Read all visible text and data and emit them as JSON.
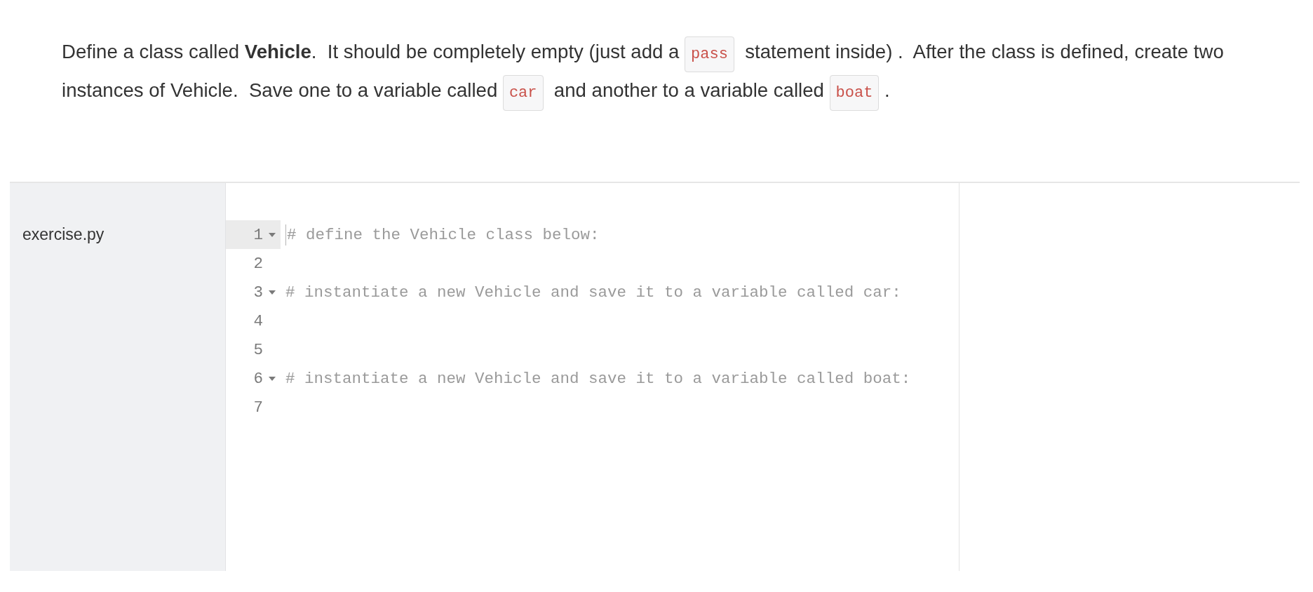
{
  "instructions": {
    "segments": [
      {
        "kind": "text",
        "text": "Define a class called **Vehicle**.  It should be completely empty (just add a "
      },
      {
        "kind": "code",
        "text": "pass"
      },
      {
        "kind": "text",
        "text": "  statement inside) .  After the class is defined, create two instances of Vehicle.  Save one to a variable called "
      },
      {
        "kind": "code",
        "text": "car"
      },
      {
        "kind": "text",
        "text": "  and another to a variable called "
      },
      {
        "kind": "code",
        "text": "boat"
      },
      {
        "kind": "text",
        "text": " ."
      }
    ]
  },
  "sidebar": {
    "files": [
      {
        "name": "exercise.py"
      }
    ]
  },
  "editor": {
    "lines": [
      {
        "number": "1",
        "fold": true,
        "active": true,
        "text": "# define the Vehicle class below:"
      },
      {
        "number": "2",
        "fold": false,
        "active": false
      },
      {
        "number": "3",
        "fold": true,
        "active": false,
        "text": "# instantiate a new Vehicle and save it to a variable called car:"
      },
      {
        "number": "4",
        "fold": false,
        "active": false
      },
      {
        "number": "5",
        "fold": false,
        "active": false
      },
      {
        "number": "6",
        "fold": true,
        "active": false,
        "text": "# instantiate a new Vehicle and save it to a variable called boat:"
      },
      {
        "number": "7",
        "fold": false,
        "active": false
      }
    ]
  }
}
